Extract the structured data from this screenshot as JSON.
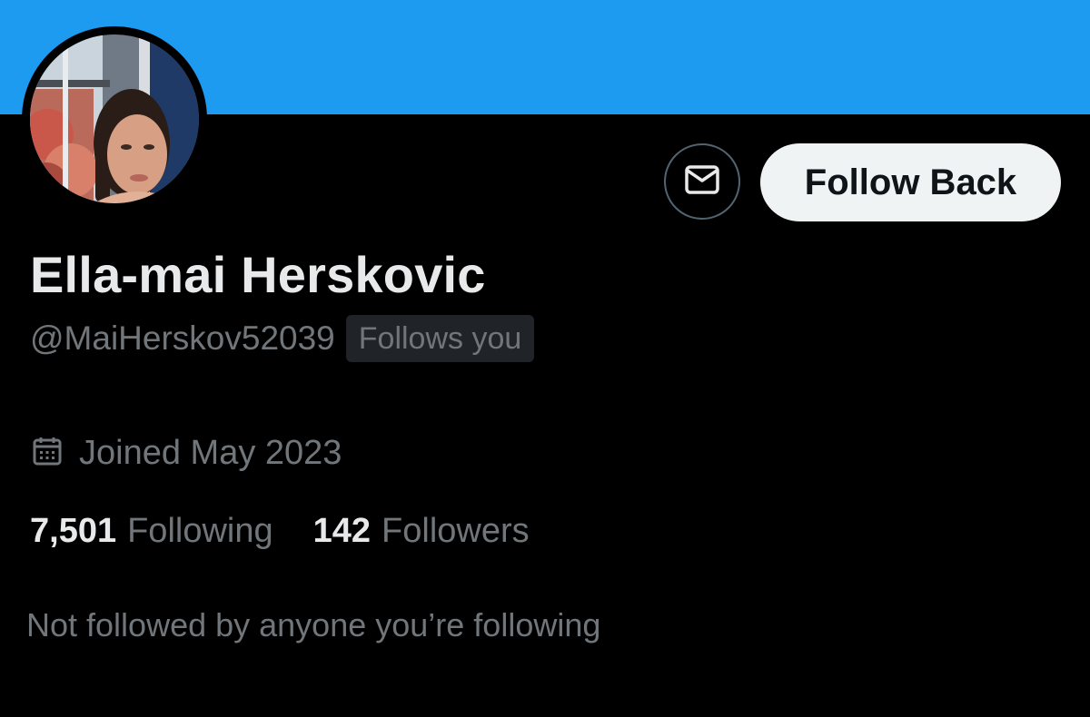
{
  "profile": {
    "display_name": "Ella-mai Herskovic",
    "handle": "@MaiHerskov52039",
    "follows_you_badge": "Follows you",
    "joined": "Joined May 2023",
    "following_count": "7,501",
    "following_label": "Following",
    "followers_count": "142",
    "followers_label": "Followers",
    "mutuals_note": "Not followed by anyone you’re following"
  },
  "actions": {
    "follow_back_label": "Follow Back",
    "message_icon": "envelope-icon"
  },
  "icons": {
    "joined": "calendar-icon"
  },
  "colors": {
    "banner": "#1d9bf0",
    "background": "#000000",
    "primary_text": "#e7e9ea",
    "secondary_text": "#71767b",
    "button_bg": "#eff3f4",
    "button_text": "#0f1419"
  }
}
